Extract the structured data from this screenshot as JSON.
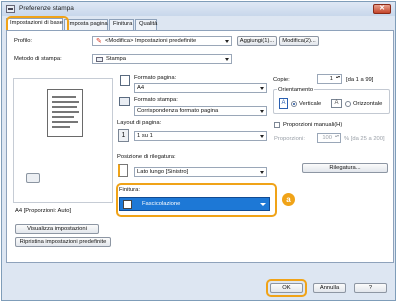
{
  "window": {
    "title": "Preferenze stampa",
    "close_glyph": "✕"
  },
  "tabs": [
    {
      "label": "Impostazioni di base"
    },
    {
      "label": "Imposta pagina"
    },
    {
      "label": "Finitura"
    },
    {
      "label": "Qualità"
    }
  ],
  "profile": {
    "label": "Profilo:",
    "value": "<Modifica> Impostazioni predefinite",
    "add_button": "Aggiungi(1)...",
    "edit_button": "Modifica(2)..."
  },
  "print_method": {
    "label": "Metodo di stampa:",
    "value": "Stampa"
  },
  "page_format": {
    "label": "Formato pagina:",
    "value": "A4"
  },
  "print_format": {
    "label": "Formato stampa:",
    "value": "Corrispondenza formato pagina"
  },
  "layout": {
    "label": "Layout di pagina:",
    "value": "1 su 1",
    "icon_text": "1"
  },
  "binding": {
    "label": "Posizione di rilegatura:",
    "value": "Lato lungo [Sinistro]",
    "button": "Rilegatura..."
  },
  "finishing": {
    "label": "Finitura:",
    "value": "Fascicolazione",
    "badge": "a"
  },
  "copies": {
    "label": "Copie:",
    "value": "1",
    "range": "[da 1 a 99]"
  },
  "orientation": {
    "label": "Orientamento",
    "vertical": "Verticale",
    "horizontal": "Orizzontale",
    "icon_letter": "A"
  },
  "manual_scaling": {
    "label": "Proporzioni manuali(H)",
    "sub_label": "Proporzioni:",
    "value": "100",
    "range": "% [da 25 a 200]"
  },
  "preview": {
    "caption": "A4 [Proporzioni: Auto]"
  },
  "left_buttons": {
    "view_settings": "Visualizza impostazioni",
    "restore_defaults": "Ripristina impostazioni predefinite"
  },
  "footer": {
    "ok": "OK",
    "cancel": "Annulla",
    "help": "?"
  },
  "colors": {
    "accent": "#f0a318",
    "selection": "#1d78d6"
  }
}
